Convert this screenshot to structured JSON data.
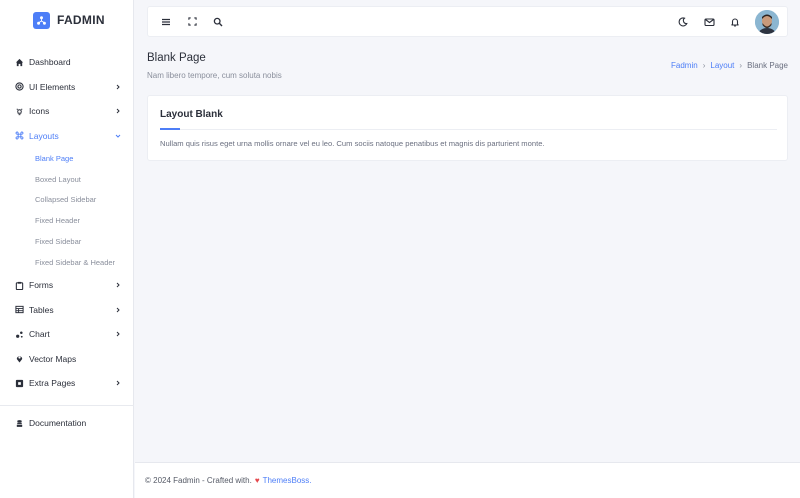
{
  "brand": {
    "name": "FADMIN",
    "accent": "#4d7ef7"
  },
  "sidebar": {
    "items": [
      {
        "label": "Dashboard",
        "icon": "home-icon"
      },
      {
        "label": "UI Elements",
        "icon": "target-icon",
        "has_children": true
      },
      {
        "label": "Icons",
        "icon": "bulb-icon",
        "has_children": true
      },
      {
        "label": "Layouts",
        "icon": "command-icon",
        "has_children": true,
        "expanded": true
      },
      {
        "label": "Forms",
        "icon": "clipboard-icon",
        "has_children": true
      },
      {
        "label": "Tables",
        "icon": "table-icon",
        "has_children": true
      },
      {
        "label": "Chart",
        "icon": "chart-icon",
        "has_children": true
      },
      {
        "label": "Vector Maps",
        "icon": "map-pin-icon"
      },
      {
        "label": "Extra Pages",
        "icon": "pages-icon",
        "has_children": true
      }
    ],
    "layouts_children": [
      {
        "label": "Blank Page",
        "active": true
      },
      {
        "label": "Boxed Layout"
      },
      {
        "label": "Collapsed Sidebar"
      },
      {
        "label": "Fixed Header"
      },
      {
        "label": "Fixed Sidebar"
      },
      {
        "label": "Fixed Sidebar & Header"
      }
    ],
    "documentation": {
      "label": "Documentation",
      "icon": "stack-icon"
    }
  },
  "topbar": {
    "left_icons": [
      "menu-icon",
      "fullscreen-icon",
      "search-icon"
    ],
    "right_icons": [
      "dark-mode-icon",
      "mail-icon",
      "bell-icon"
    ]
  },
  "page": {
    "title": "Blank Page",
    "subtitle": "Nam libero tempore, cum soluta nobis",
    "breadcrumb": [
      "Fadmin",
      "Layout",
      "Blank Page"
    ]
  },
  "card": {
    "title": "Layout Blank",
    "text": "Nullam quis risus eget urna mollis ornare vel eu leo. Cum sociis natoque penatibus et magnis dis parturient monte."
  },
  "footer": {
    "prefix": "© 2024 Fadmin - Crafted with.",
    "link": "ThemesBoss."
  }
}
